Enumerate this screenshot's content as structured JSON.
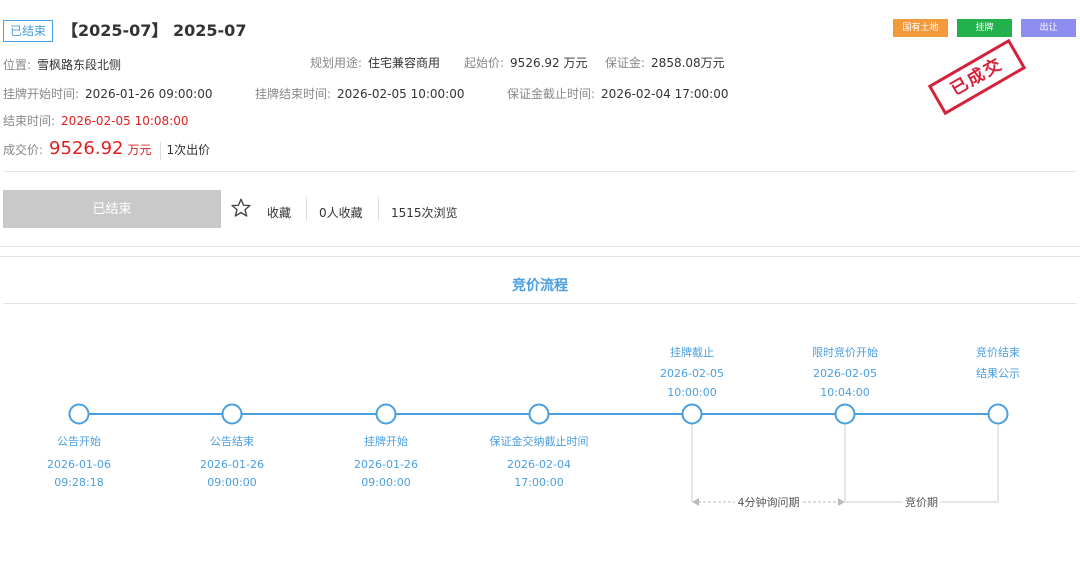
{
  "header": {
    "status_tag": "已结束",
    "title": "【2025-07】 2025-07",
    "tags": [
      "国有土地",
      "挂牌",
      "出让"
    ],
    "stamp": "已成交"
  },
  "info": {
    "location_label": "位置:",
    "location_value": "雪枫路东段北侧",
    "usage_label": "规划用途:",
    "usage_value": "住宅兼容商用",
    "start_price_label": "起始价:",
    "start_price_value": "9526.92 万元",
    "deposit_label": "保证金:",
    "deposit_value": "2858.08万元",
    "listing_start_label": "挂牌开始时间:",
    "listing_start_value": "2026-01-26 09:00:00",
    "listing_end_label": "挂牌结束时间:",
    "listing_end_value": "2026-02-05 10:00:00",
    "deposit_deadline_label": "保证金截止时间:",
    "deposit_deadline_value": "2026-02-04 17:00:00",
    "end_time_label": "结束时间:",
    "end_time_value": "2026-02-05 10:08:00",
    "deal_price_label": "成交价:",
    "deal_price_value": "9526.92",
    "deal_price_unit": "万元",
    "bid_count": "1次出价"
  },
  "actions": {
    "ended_button": "已结束",
    "favorite_label": "收藏",
    "favorite_count": "0人收藏",
    "view_count": "1515次浏览"
  },
  "process": {
    "title": "竞价流程",
    "steps": [
      {
        "label": "公告开始",
        "date": "2026-01-06",
        "time": "09:28:18",
        "position": "below"
      },
      {
        "label": "公告结束",
        "date": "2026-01-26",
        "time": "09:00:00",
        "position": "below"
      },
      {
        "label": "挂牌开始",
        "date": "2026-01-26",
        "time": "09:00:00",
        "position": "below"
      },
      {
        "label": "保证金交纳截止时间",
        "date": "2026-02-04",
        "time": "17:00:00",
        "position": "below"
      },
      {
        "label": "挂牌截止",
        "date": "2026-02-05",
        "time": "10:00:00",
        "position": "above"
      },
      {
        "label": "限时竞价开始",
        "date": "2026-02-05",
        "time": "10:04:00",
        "position": "above"
      },
      {
        "label": "竞价结束",
        "date": "结果公示",
        "time": "",
        "position": "above"
      }
    ],
    "inquiry_period": "4分钟询问期",
    "bidding_period": "竞价期"
  },
  "colors": {
    "accent": "#4a9fe0",
    "price_red": "#e0201f",
    "stamp_red": "#d6213a",
    "tag_orange": "#f39a3c",
    "tag_green": "#22b14c",
    "tag_purple": "#8e8ef0"
  }
}
